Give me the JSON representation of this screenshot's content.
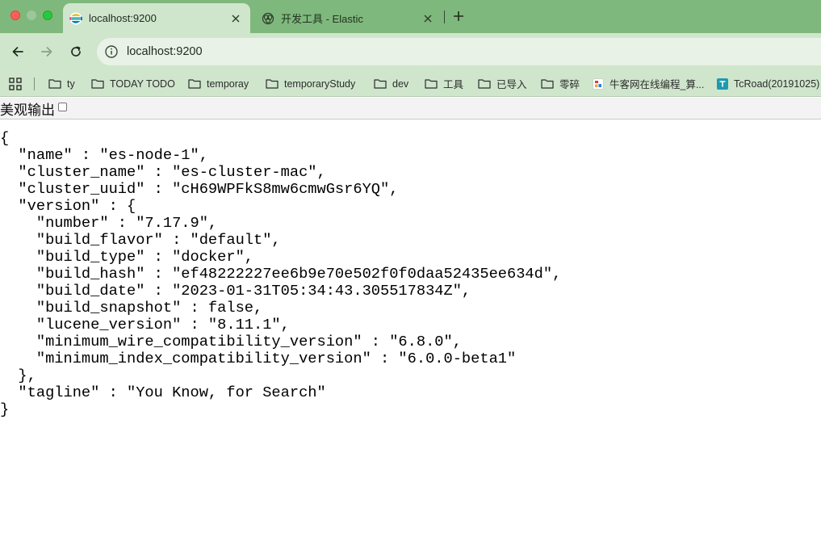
{
  "window_controls": [
    "close",
    "minimize",
    "maximize"
  ],
  "tabs": [
    {
      "title": "localhost:9200",
      "active": true,
      "favicon": "elastic-logo-icon"
    },
    {
      "title": "开发工具 - Elastic",
      "active": false,
      "favicon": "elastic-devtools-icon"
    }
  ],
  "toolbar": {
    "url": "localhost:9200"
  },
  "bookmarks": {
    "items": [
      {
        "label": "ty",
        "icon": "folder-icon"
      },
      {
        "label": "TODAY TODO",
        "icon": "folder-icon"
      },
      {
        "label": "temporay",
        "icon": "folder-icon"
      },
      {
        "label": "temporaryStudy",
        "icon": "folder-icon"
      },
      {
        "label": "dev",
        "icon": "folder-icon"
      },
      {
        "label": "工具",
        "icon": "folder-icon"
      },
      {
        "label": "已导入",
        "icon": "folder-icon"
      },
      {
        "label": "零碎",
        "icon": "folder-icon"
      },
      {
        "label": "牛客网在线编程_算...",
        "icon": "nowcoder-favicon"
      },
      {
        "label": "TcRoad(20191025)",
        "icon": "tcroad-favicon"
      }
    ]
  },
  "page": {
    "pretty_print_label": "美观输出",
    "pretty_print_checked": false,
    "json_lines": [
      "{",
      "  \"name\" : \"es-node-1\",",
      "  \"cluster_name\" : \"es-cluster-mac\",",
      "  \"cluster_uuid\" : \"cH69WPFkS8mw6cmwGsr6YQ\",",
      "  \"version\" : {",
      "    \"number\" : \"7.17.9\",",
      "    \"build_flavor\" : \"default\",",
      "    \"build_type\" : \"docker\",",
      "    \"build_hash\" : \"ef48222227ee6b9e70e502f0f0daa52435ee634d\",",
      "    \"build_date\" : \"2023-01-31T05:34:43.305517834Z\",",
      "    \"build_snapshot\" : false,",
      "    \"lucene_version\" : \"8.11.1\",",
      "    \"minimum_wire_compatibility_version\" : \"6.8.0\",",
      "    \"minimum_index_compatibility_version\" : \"6.0.0-beta1\"",
      "  },",
      "  \"tagline\" : \"You Know, for Search\"",
      "}"
    ]
  },
  "colors": {
    "frame": "#7fb87c",
    "toolbar": "#cfe6cc",
    "omnibox": "#e9f2e7"
  }
}
